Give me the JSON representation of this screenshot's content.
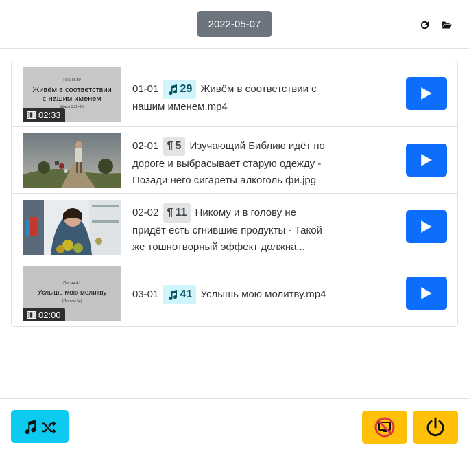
{
  "header": {
    "date": "2022-05-07",
    "refresh_icon": "refresh-icon",
    "folder_icon": "folder-open-icon"
  },
  "items": [
    {
      "code": "01-01",
      "tag_type": "song",
      "tag_value": "29",
      "title_line1": "Живём в соответствии с",
      "title_line2": "нашим именем.mp4",
      "title_line3": "",
      "duration": "02:33",
      "thumb_kind": "slide",
      "slide_label": "Песня 29",
      "slide_title1": "Живём в соответствии",
      "slide_title2": "с нашим именем",
      "slide_sub": "(Иаков 1:22–25)"
    },
    {
      "code": "02-01",
      "tag_type": "para",
      "tag_value": "5",
      "title_line1": "Изучающий Библию идёт по",
      "title_line2": "дороге и выбрасывает старую одежду -",
      "title_line3": "Позади него сигареты алкоголь фи.jpg",
      "duration": "",
      "thumb_kind": "photo-road"
    },
    {
      "code": "02-02",
      "tag_type": "para",
      "tag_value": "11",
      "title_line1": "Никому и в голову не",
      "title_line2": "придёт есть сгнившие продукты - Такой",
      "title_line3": "же тошнотворный эффект должна...",
      "duration": "",
      "thumb_kind": "photo-fridge"
    },
    {
      "code": "03-01",
      "tag_type": "song",
      "tag_value": "41",
      "title_line1": "Услышь мою молитву.mp4",
      "title_line2": "",
      "title_line3": "",
      "duration": "02:00",
      "thumb_kind": "slide",
      "slide_label": "Песня 41",
      "slide_title1": "Услышь мою молитву",
      "slide_title2": "",
      "slide_sub": "(Псалом 54)"
    }
  ],
  "footer": {
    "shuffle_icons": [
      "music-note-icon",
      "shuffle-icon"
    ],
    "screen_off_icon": "screen-off-icon",
    "power_icon": "power-icon"
  },
  "colors": {
    "primary": "#0d6efd",
    "info": "#0dcaf0",
    "warning": "#ffc107",
    "secondary": "#6c757d"
  }
}
